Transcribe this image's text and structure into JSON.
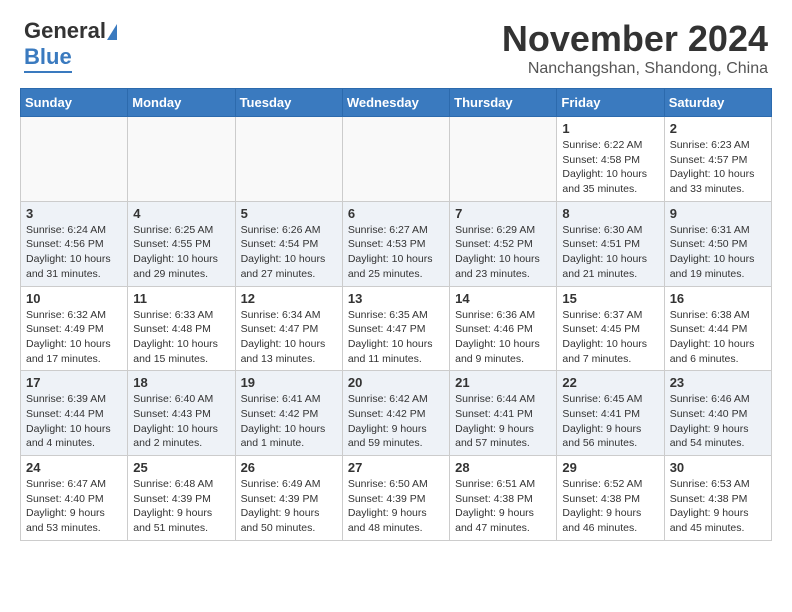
{
  "header": {
    "logo_line1": "General",
    "logo_line2": "Blue",
    "month_title": "November 2024",
    "location": "Nanchangshan, Shandong, China"
  },
  "calendar": {
    "weekdays": [
      "Sunday",
      "Monday",
      "Tuesday",
      "Wednesday",
      "Thursday",
      "Friday",
      "Saturday"
    ],
    "weeks": [
      [
        {
          "day": "",
          "info": ""
        },
        {
          "day": "",
          "info": ""
        },
        {
          "day": "",
          "info": ""
        },
        {
          "day": "",
          "info": ""
        },
        {
          "day": "",
          "info": ""
        },
        {
          "day": "1",
          "info": "Sunrise: 6:22 AM\nSunset: 4:58 PM\nDaylight: 10 hours\nand 35 minutes."
        },
        {
          "day": "2",
          "info": "Sunrise: 6:23 AM\nSunset: 4:57 PM\nDaylight: 10 hours\nand 33 minutes."
        }
      ],
      [
        {
          "day": "3",
          "info": "Sunrise: 6:24 AM\nSunset: 4:56 PM\nDaylight: 10 hours\nand 31 minutes."
        },
        {
          "day": "4",
          "info": "Sunrise: 6:25 AM\nSunset: 4:55 PM\nDaylight: 10 hours\nand 29 minutes."
        },
        {
          "day": "5",
          "info": "Sunrise: 6:26 AM\nSunset: 4:54 PM\nDaylight: 10 hours\nand 27 minutes."
        },
        {
          "day": "6",
          "info": "Sunrise: 6:27 AM\nSunset: 4:53 PM\nDaylight: 10 hours\nand 25 minutes."
        },
        {
          "day": "7",
          "info": "Sunrise: 6:29 AM\nSunset: 4:52 PM\nDaylight: 10 hours\nand 23 minutes."
        },
        {
          "day": "8",
          "info": "Sunrise: 6:30 AM\nSunset: 4:51 PM\nDaylight: 10 hours\nand 21 minutes."
        },
        {
          "day": "9",
          "info": "Sunrise: 6:31 AM\nSunset: 4:50 PM\nDaylight: 10 hours\nand 19 minutes."
        }
      ],
      [
        {
          "day": "10",
          "info": "Sunrise: 6:32 AM\nSunset: 4:49 PM\nDaylight: 10 hours\nand 17 minutes."
        },
        {
          "day": "11",
          "info": "Sunrise: 6:33 AM\nSunset: 4:48 PM\nDaylight: 10 hours\nand 15 minutes."
        },
        {
          "day": "12",
          "info": "Sunrise: 6:34 AM\nSunset: 4:47 PM\nDaylight: 10 hours\nand 13 minutes."
        },
        {
          "day": "13",
          "info": "Sunrise: 6:35 AM\nSunset: 4:47 PM\nDaylight: 10 hours\nand 11 minutes."
        },
        {
          "day": "14",
          "info": "Sunrise: 6:36 AM\nSunset: 4:46 PM\nDaylight: 10 hours\nand 9 minutes."
        },
        {
          "day": "15",
          "info": "Sunrise: 6:37 AM\nSunset: 4:45 PM\nDaylight: 10 hours\nand 7 minutes."
        },
        {
          "day": "16",
          "info": "Sunrise: 6:38 AM\nSunset: 4:44 PM\nDaylight: 10 hours\nand 6 minutes."
        }
      ],
      [
        {
          "day": "17",
          "info": "Sunrise: 6:39 AM\nSunset: 4:44 PM\nDaylight: 10 hours\nand 4 minutes."
        },
        {
          "day": "18",
          "info": "Sunrise: 6:40 AM\nSunset: 4:43 PM\nDaylight: 10 hours\nand 2 minutes."
        },
        {
          "day": "19",
          "info": "Sunrise: 6:41 AM\nSunset: 4:42 PM\nDaylight: 10 hours\nand 1 minute."
        },
        {
          "day": "20",
          "info": "Sunrise: 6:42 AM\nSunset: 4:42 PM\nDaylight: 9 hours\nand 59 minutes."
        },
        {
          "day": "21",
          "info": "Sunrise: 6:44 AM\nSunset: 4:41 PM\nDaylight: 9 hours\nand 57 minutes."
        },
        {
          "day": "22",
          "info": "Sunrise: 6:45 AM\nSunset: 4:41 PM\nDaylight: 9 hours\nand 56 minutes."
        },
        {
          "day": "23",
          "info": "Sunrise: 6:46 AM\nSunset: 4:40 PM\nDaylight: 9 hours\nand 54 minutes."
        }
      ],
      [
        {
          "day": "24",
          "info": "Sunrise: 6:47 AM\nSunset: 4:40 PM\nDaylight: 9 hours\nand 53 minutes."
        },
        {
          "day": "25",
          "info": "Sunrise: 6:48 AM\nSunset: 4:39 PM\nDaylight: 9 hours\nand 51 minutes."
        },
        {
          "day": "26",
          "info": "Sunrise: 6:49 AM\nSunset: 4:39 PM\nDaylight: 9 hours\nand 50 minutes."
        },
        {
          "day": "27",
          "info": "Sunrise: 6:50 AM\nSunset: 4:39 PM\nDaylight: 9 hours\nand 48 minutes."
        },
        {
          "day": "28",
          "info": "Sunrise: 6:51 AM\nSunset: 4:38 PM\nDaylight: 9 hours\nand 47 minutes."
        },
        {
          "day": "29",
          "info": "Sunrise: 6:52 AM\nSunset: 4:38 PM\nDaylight: 9 hours\nand 46 minutes."
        },
        {
          "day": "30",
          "info": "Sunrise: 6:53 AM\nSunset: 4:38 PM\nDaylight: 9 hours\nand 45 minutes."
        }
      ]
    ]
  }
}
